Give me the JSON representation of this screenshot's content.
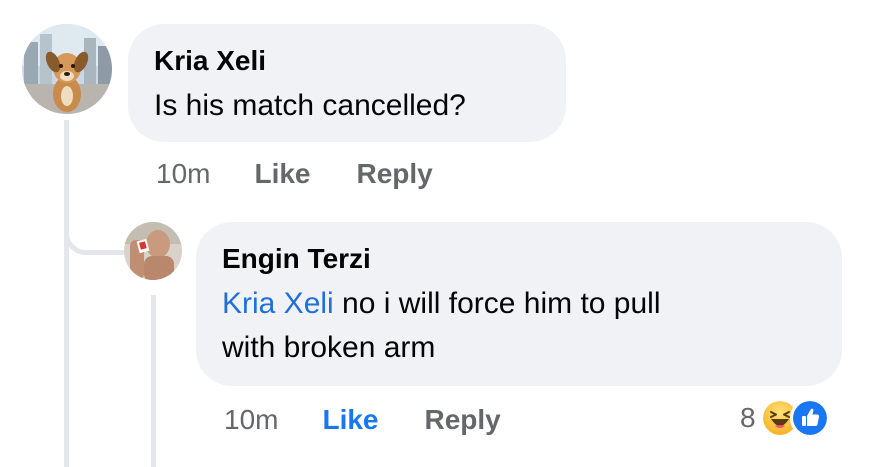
{
  "comment": {
    "author": "Kria Xeli",
    "text": "Is his match cancelled?",
    "time": "10m",
    "like_label": "Like",
    "reply_label": "Reply"
  },
  "reply": {
    "author": "Engin Terzi",
    "mention": "Kria Xeli",
    "text_line1": " no i will force him to pull",
    "text_line2": "with broken arm",
    "time": "10m",
    "like_label": "Like",
    "reply_label": "Reply",
    "liked": true,
    "reaction_count": "8",
    "reaction_icons": [
      "haha-icon",
      "like-icon"
    ]
  },
  "colors": {
    "bubble_bg": "#f0f2f5",
    "meta_text": "#65676b",
    "link_blue": "#1877f2",
    "mention_blue": "#216fdb",
    "thread_line": "#e4e6eb"
  }
}
